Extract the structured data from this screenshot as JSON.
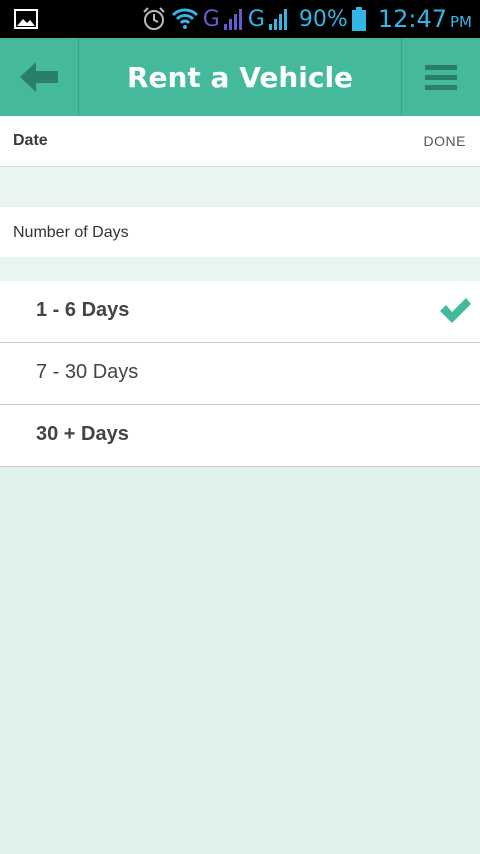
{
  "status_bar": {
    "network_1": "G",
    "network_2": "G",
    "battery": "90%",
    "time": "12:47",
    "ampm": "PM"
  },
  "header": {
    "title": "Rent a Vehicle",
    "back_icon": "arrow-left-icon",
    "menu_icon": "hamburger-menu-icon",
    "color": "#45b99c"
  },
  "date_row": {
    "label": "Date",
    "done": "DONE"
  },
  "days_row": {
    "label": "Number of Days"
  },
  "options": [
    {
      "label": "1 - 6 Days",
      "selected": true
    },
    {
      "label": "7 - 30 Days",
      "selected": false
    },
    {
      "label": "30 + Days",
      "selected": false
    }
  ],
  "colors": {
    "accent": "#45b99c",
    "background": "#dff1ec"
  }
}
